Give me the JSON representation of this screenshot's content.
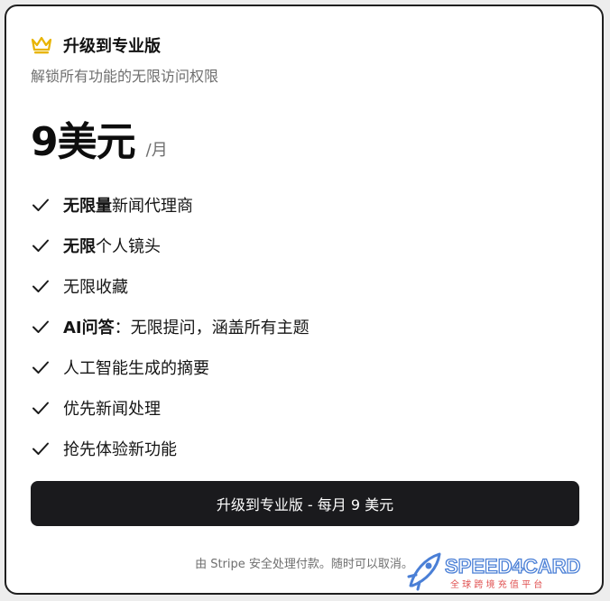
{
  "header": {
    "title": "升级到专业版",
    "icon": "crown-icon",
    "icon_color": "#e8b400"
  },
  "subtitle": "解锁所有功能的无限访问权限",
  "price": {
    "amount": "9美元",
    "period": "/月"
  },
  "features": [
    {
      "bold": "无限量",
      "text": "新闻代理商"
    },
    {
      "bold": "无限",
      "text": "个人镜头"
    },
    {
      "bold": "",
      "text": "无限收藏"
    },
    {
      "bold": "AI问答",
      "text": "：无限提问，涵盖所有主题"
    },
    {
      "bold": "",
      "text": "人工智能生成的摘要"
    },
    {
      "bold": "",
      "text": "优先新闻处理"
    },
    {
      "bold": "",
      "text": "抢先体验新功能"
    }
  ],
  "cta": {
    "label": "升级到专业版 - 每月 9 美元",
    "color": "#1a1a1d"
  },
  "footnote": "由 Stripe 安全处理付款。随时可以取消。",
  "watermark": {
    "brand": "SPEED4CARD",
    "tagline": "全 球 跨 境 充 值 平 台",
    "color": "#4a7fd6"
  }
}
